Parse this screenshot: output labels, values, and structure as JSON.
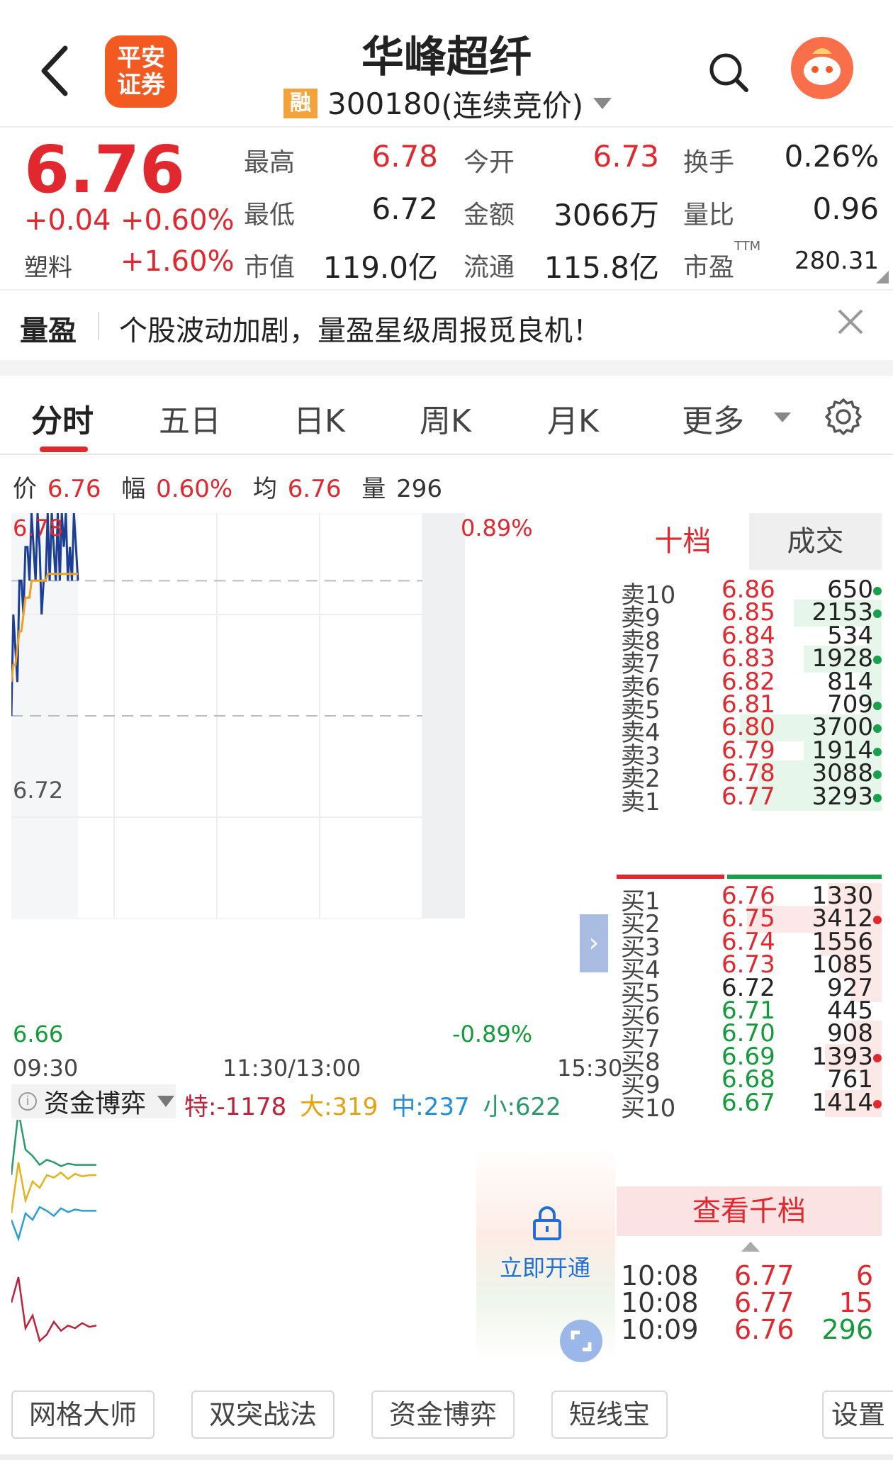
{
  "header": {
    "logo_line1": "平安",
    "logo_line2": "证券",
    "title": "华峰超纤",
    "margin_badge": "融",
    "stock_code": "300180",
    "trading_status": "(连续竞价)",
    "icons": {
      "back": "back-chevron-icon",
      "search": "search-icon",
      "avatar": "assistant-avatar-icon"
    }
  },
  "quote": {
    "price": "6.76",
    "change": "+0.04",
    "change_pct": "+0.60%",
    "sector": "塑料",
    "sector_pct": "+1.60%",
    "fields": [
      {
        "label": "最高",
        "value": "6.78",
        "color": "red"
      },
      {
        "label": "今开",
        "value": "6.73",
        "color": "red"
      },
      {
        "label": "换手",
        "value": "0.26%",
        "color": "black"
      },
      {
        "label": "最低",
        "value": "6.72",
        "color": "black"
      },
      {
        "label": "金额",
        "value": "3066万",
        "color": "black"
      },
      {
        "label": "量比",
        "value": "0.96",
        "color": "black"
      },
      {
        "label": "市值",
        "value": "119.0亿",
        "color": "black"
      },
      {
        "label": "流通",
        "value": "115.8亿",
        "color": "black"
      },
      {
        "label": "市盈",
        "value": "280.31",
        "color": "black"
      }
    ],
    "pe_tag": "TTM"
  },
  "banner": {
    "brand": "量盈",
    "text": "个股波动加剧，量盈星级周报觅良机！",
    "close_icon": "close-icon"
  },
  "tabs": [
    {
      "label": "分时",
      "active": true
    },
    {
      "label": "五日",
      "active": false
    },
    {
      "label": "日K",
      "active": false
    },
    {
      "label": "周K",
      "active": false
    },
    {
      "label": "月K",
      "active": false
    },
    {
      "label": "更多",
      "active": false
    }
  ],
  "settings_icon": "gear-icon",
  "infoline": {
    "price_label": "价",
    "price": "6.76",
    "range_label": "幅",
    "range": "0.60%",
    "avg_label": "均",
    "avg": "6.76",
    "vol_label": "量",
    "vol": "296"
  },
  "chart_data": {
    "type": "line",
    "y_top_label": "6.78",
    "y_mid_label": "6.72",
    "y_bottom_label": "6.66",
    "pct_top_label": "0.89%",
    "pct_bottom_label": "-0.89%",
    "ylim": [
      6.66,
      6.78
    ],
    "x_ticks": [
      "09:30",
      "11:30/13:00",
      "15:30"
    ],
    "prev_close": 6.72,
    "series": [
      {
        "name": "价",
        "color": "#1c3f95",
        "values": [
          6.72,
          6.75,
          6.74,
          6.73,
          6.76,
          6.76,
          6.75,
          6.77,
          6.77,
          6.76,
          6.78,
          6.77,
          6.76,
          6.78,
          6.77,
          6.75,
          6.76,
          6.76,
          6.78,
          6.76,
          6.78,
          6.77,
          6.76,
          6.78,
          6.76,
          6.78,
          6.77,
          6.78,
          6.76,
          6.77,
          6.76,
          6.78,
          6.77,
          6.76
        ]
      },
      {
        "name": "均",
        "color": "#f0a020",
        "values": [
          6.73,
          6.735,
          6.735,
          6.74,
          6.745,
          6.745,
          6.75,
          6.755,
          6.755,
          6.755,
          6.76,
          6.76,
          6.76,
          6.76,
          6.76,
          6.76,
          6.76,
          6.76,
          6.762,
          6.762,
          6.762,
          6.762,
          6.762,
          6.762,
          6.762,
          6.762,
          6.762,
          6.762,
          6.762,
          6.762,
          6.762,
          6.762,
          6.762,
          6.762
        ]
      }
    ]
  },
  "flow": {
    "title": "资金博弈",
    "info_icon": "info-icon",
    "special_label": "特:",
    "special": "-1178",
    "big_label": "大:",
    "big": "319",
    "mid_label": "中:",
    "mid": "237",
    "small_label": "小:",
    "small": "622",
    "unlock_label": "立即开通",
    "lock_icon": "lock-icon",
    "fullscreen_icon": "fullscreen-icon",
    "series": [
      {
        "name": "特",
        "color": "#c0203a",
        "values": [
          -60,
          -40,
          -80,
          -70,
          -90,
          -85,
          -75,
          -82,
          -78,
          -80,
          -76,
          -79,
          -78
        ]
      },
      {
        "name": "大",
        "color": "#e6b21a",
        "values": [
          10,
          50,
          20,
          35,
          30,
          40,
          38,
          42,
          37,
          41,
          39,
          40,
          40
        ]
      },
      {
        "name": "中",
        "color": "#2a9ed8",
        "values": [
          5,
          -10,
          10,
          5,
          15,
          12,
          8,
          14,
          11,
          13,
          12,
          12,
          12
        ]
      },
      {
        "name": "小",
        "color": "#2a9a6a",
        "values": [
          40,
          90,
          60,
          55,
          48,
          52,
          50,
          47,
          49,
          48,
          48,
          48,
          48
        ]
      }
    ]
  },
  "orderbook": {
    "tab_active": "十档",
    "tab_other": "成交",
    "asks": [
      {
        "label": "卖10",
        "price": "6.86",
        "vol": "650",
        "bar": 0.0,
        "dot": "green"
      },
      {
        "label": "卖9",
        "price": "6.85",
        "vol": "2153",
        "bar": 0.62,
        "dot": "green"
      },
      {
        "label": "卖8",
        "price": "6.84",
        "vol": "534",
        "bar": 0.1,
        "dot": ""
      },
      {
        "label": "卖7",
        "price": "6.83",
        "vol": "1928",
        "bar": 0.55,
        "dot": "green"
      },
      {
        "label": "卖6",
        "price": "6.82",
        "vol": "814",
        "bar": 0.15,
        "dot": ""
      },
      {
        "label": "卖5",
        "price": "6.81",
        "vol": "709",
        "bar": 0.12,
        "dot": "green"
      },
      {
        "label": "卖4",
        "price": "6.80",
        "vol": "3700",
        "bar": 1.0,
        "dot": "green"
      },
      {
        "label": "卖3",
        "price": "6.79",
        "vol": "1914",
        "bar": 0.55,
        "dot": "green"
      },
      {
        "label": "卖2",
        "price": "6.78",
        "vol": "3088",
        "bar": 0.87,
        "dot": "green"
      },
      {
        "label": "卖1",
        "price": "6.77",
        "vol": "3293",
        "bar": 0.92,
        "dot": "green"
      }
    ],
    "bids": [
      {
        "label": "买1",
        "price": "6.76",
        "vol": "1330",
        "bar": 0.38,
        "dot": ""
      },
      {
        "label": "买2",
        "price": "6.75",
        "vol": "3412",
        "bar": 0.95,
        "dot": "red"
      },
      {
        "label": "买3",
        "price": "6.74",
        "vol": "1556",
        "bar": 0.44,
        "dot": ""
      },
      {
        "label": "买4",
        "price": "6.73",
        "vol": "1085",
        "bar": 0.3,
        "dot": ""
      },
      {
        "label": "买5",
        "price": "6.72",
        "vol": "927",
        "bar": 0.22,
        "dot": ""
      },
      {
        "label": "买6",
        "price": "6.71",
        "vol": "445",
        "bar": 0.0,
        "dot": ""
      },
      {
        "label": "买7",
        "price": "6.70",
        "vol": "908",
        "bar": 0.22,
        "dot": ""
      },
      {
        "label": "买8",
        "price": "6.69",
        "vol": "1393",
        "bar": 0.4,
        "dot": "red"
      },
      {
        "label": "买9",
        "price": "6.68",
        "vol": "761",
        "bar": 0.15,
        "dot": ""
      },
      {
        "label": "买10",
        "price": "6.67",
        "vol": "1414",
        "bar": 0.4,
        "dot": "red"
      }
    ],
    "more_label": "查看千档",
    "trades": [
      {
        "time": "10:08",
        "price": "6.77",
        "vol": "6",
        "vol_color": "red"
      },
      {
        "time": "10:08",
        "price": "6.77",
        "vol": "15",
        "vol_color": "red"
      },
      {
        "time": "10:09",
        "price": "6.76",
        "vol": "296",
        "vol_color": "green"
      }
    ]
  },
  "tools": [
    "网格大师",
    "双突战法",
    "资金博弈",
    "短线宝",
    "设置"
  ],
  "colors": {
    "up": "#e0282e",
    "down": "#139b3a",
    "accent": "#f25a22"
  }
}
